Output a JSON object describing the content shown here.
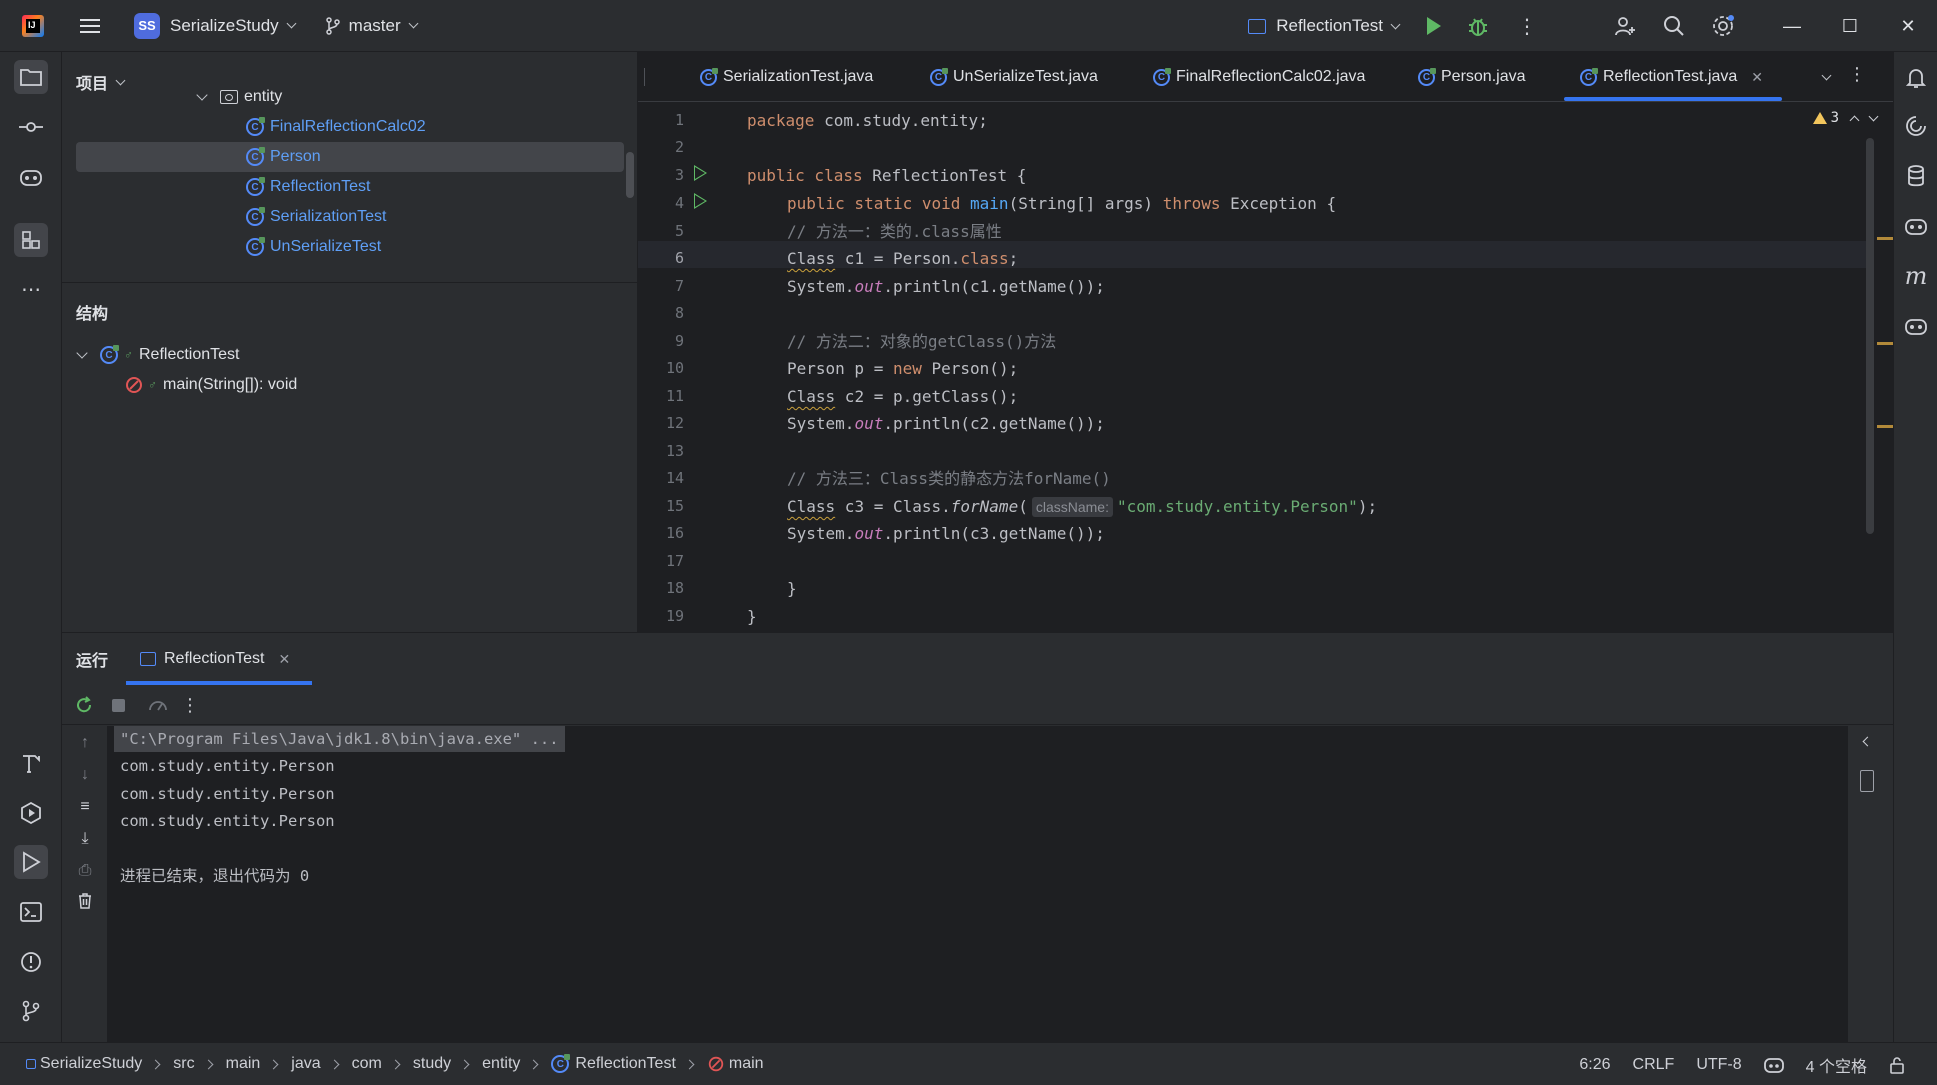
{
  "titlebar": {
    "project_badge": "SS",
    "project_name": "SerializeStudy",
    "branch": "master",
    "run_config": "ReflectionTest"
  },
  "project_panel": {
    "title": "项目",
    "tree": [
      {
        "label": "entity",
        "kind": "folder"
      },
      {
        "label": "FinalReflectionCalc02",
        "kind": "class"
      },
      {
        "label": "Person",
        "kind": "class",
        "selected": true
      },
      {
        "label": "ReflectionTest",
        "kind": "class"
      },
      {
        "label": "SerializationTest",
        "kind": "class"
      },
      {
        "label": "UnSerializeTest",
        "kind": "class"
      }
    ],
    "structure_title": "结构",
    "structure": [
      {
        "label": "ReflectionTest"
      },
      {
        "label": "main(String[]): void"
      }
    ]
  },
  "tabs": [
    {
      "label": "SerializationTest.java"
    },
    {
      "label": "UnSerializeTest.java"
    },
    {
      "label": "FinalReflectionCalc02.java"
    },
    {
      "label": "Person.java"
    },
    {
      "label": "ReflectionTest.java",
      "active": true
    }
  ],
  "editor": {
    "warning_count": "3",
    "line_numbers": [
      "1",
      "2",
      "3",
      "4",
      "5",
      "6",
      "7",
      "8",
      "9",
      "10",
      "11",
      "12",
      "13",
      "14",
      "15",
      "16",
      "17",
      "18",
      "19"
    ],
    "current_line": "6",
    "inlay_hint": "className:",
    "lines": {
      "l1": "package com.study.entity;",
      "l3_kw": "public class ",
      "l3_rest": "ReflectionTest {",
      "l4_kw": "public static void ",
      "l4_fn": "main",
      "l4_args": "(String[] args) ",
      "l4_throws": "throws",
      "l4_end": " Exception {",
      "l5": "// 方法一：类的.class属性",
      "l6_cls": "Class",
      "l6_mid": " c1 = Person.",
      "l6_kw": "class",
      "l6_end": ";",
      "l7_a": "System.",
      "l7_out": "out",
      "l7_b": ".println(c1.getName());",
      "l9": "// 方法二：对象的getClass()方法",
      "l10_a": "Person p = ",
      "l10_kw": "new",
      "l10_b": " Person();",
      "l11_cls": "Class",
      "l11_b": " c2 = p.getClass();",
      "l12_a": "System.",
      "l12_out": "out",
      "l12_b": ".println(c2.getName());",
      "l14": "// 方法三：Class类的静态方法forName()",
      "l15_cls": "Class",
      "l15_b": " c3 = Class.",
      "l15_fn": "forName",
      "l15_paren": "(",
      "l15_str": "\"com.study.entity.Person\"",
      "l15_end": ");",
      "l16_a": "System.",
      "l16_out": "out",
      "l16_b": ".println(c3.getName());",
      "l18": "}",
      "l19": "}"
    }
  },
  "run_panel": {
    "title": "运行",
    "tab_label": "ReflectionTest",
    "console": [
      "\"C:\\Program Files\\Java\\jdk1.8\\bin\\java.exe\" ...",
      "com.study.entity.Person",
      "com.study.entity.Person",
      "com.study.entity.Person",
      "",
      "进程已结束，退出代码为 0"
    ]
  },
  "statusbar": {
    "breadcrumb": [
      "SerializeStudy",
      "src",
      "main",
      "java",
      "com",
      "study",
      "entity",
      "ReflectionTest",
      "main"
    ],
    "position": "6:26",
    "line_sep": "CRLF",
    "encoding": "UTF-8",
    "indent": "4 个空格"
  },
  "colors": {
    "accent": "#3574f0",
    "background": "#1e1f22",
    "panel": "#2b2d30",
    "run_green": "#5fb865",
    "keyword": "#cf8e6d",
    "string": "#6aab73",
    "function": "#56a8f5",
    "comment": "#7a7e85",
    "warning": "#f2c55c"
  }
}
